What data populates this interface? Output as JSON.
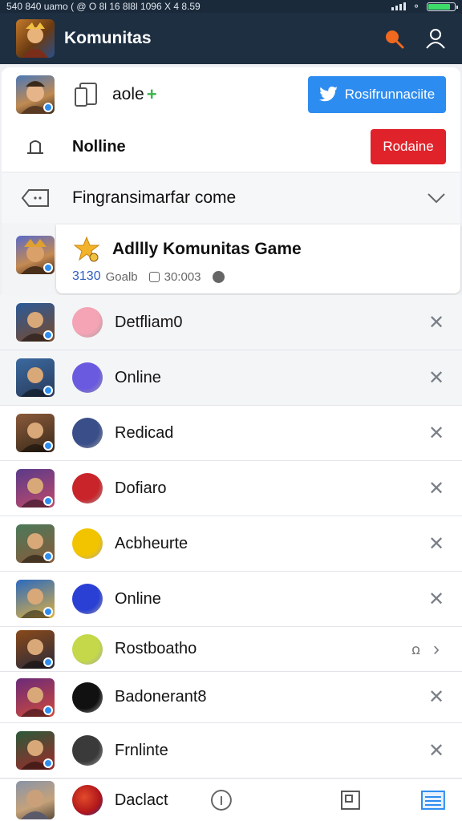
{
  "status": {
    "left": "540 840  uamo ( @ O 8l 16 8l8l 1096 X 4 8.59",
    "battery_level": 0.85
  },
  "appbar": {
    "title": "Komunitas"
  },
  "profile": {
    "name": "aole",
    "plus": "+",
    "twitter_button": "Rosifrunnaciite"
  },
  "notice": {
    "label": "Nolline",
    "button": "Rodaine"
  },
  "filter": {
    "label": "Fingransimarfar come"
  },
  "community": {
    "title": "Adllly Komunitas Game",
    "meta_count": "3130",
    "meta_label": "Goalb",
    "meta_time": "30:003"
  },
  "list": [
    {
      "label": "Detfliam0",
      "action": "close-icon",
      "color": "#f4a4b4"
    },
    {
      "label": "Online",
      "action": "close-icon",
      "color": "#6a5ae0"
    },
    {
      "label": "Redicad",
      "action": "close-icon",
      "color": "#3a4f8a"
    },
    {
      "label": "Dofiaro",
      "action": "close-icon",
      "color": "#c8242a"
    },
    {
      "label": "Acbheurte",
      "action": "close-icon",
      "color": "#f2c400"
    },
    {
      "label": "Online",
      "action": "close-icon",
      "color": "#2a3fd4"
    },
    {
      "label": "Rostboatho",
      "action": "chevron-right-icon",
      "extra": "ꭥ",
      "color": "#c4d84a"
    },
    {
      "label": "Badonerant8",
      "action": "close-icon",
      "color": "#111111"
    },
    {
      "label": "Frnlinte",
      "action": "close-icon",
      "color": "#3a3a3a"
    }
  ],
  "bottom": {
    "label": "Daclact"
  },
  "colors": {
    "accent": "#2d8cf0",
    "danger": "#e0222a",
    "appbar": "#1e2f42"
  }
}
